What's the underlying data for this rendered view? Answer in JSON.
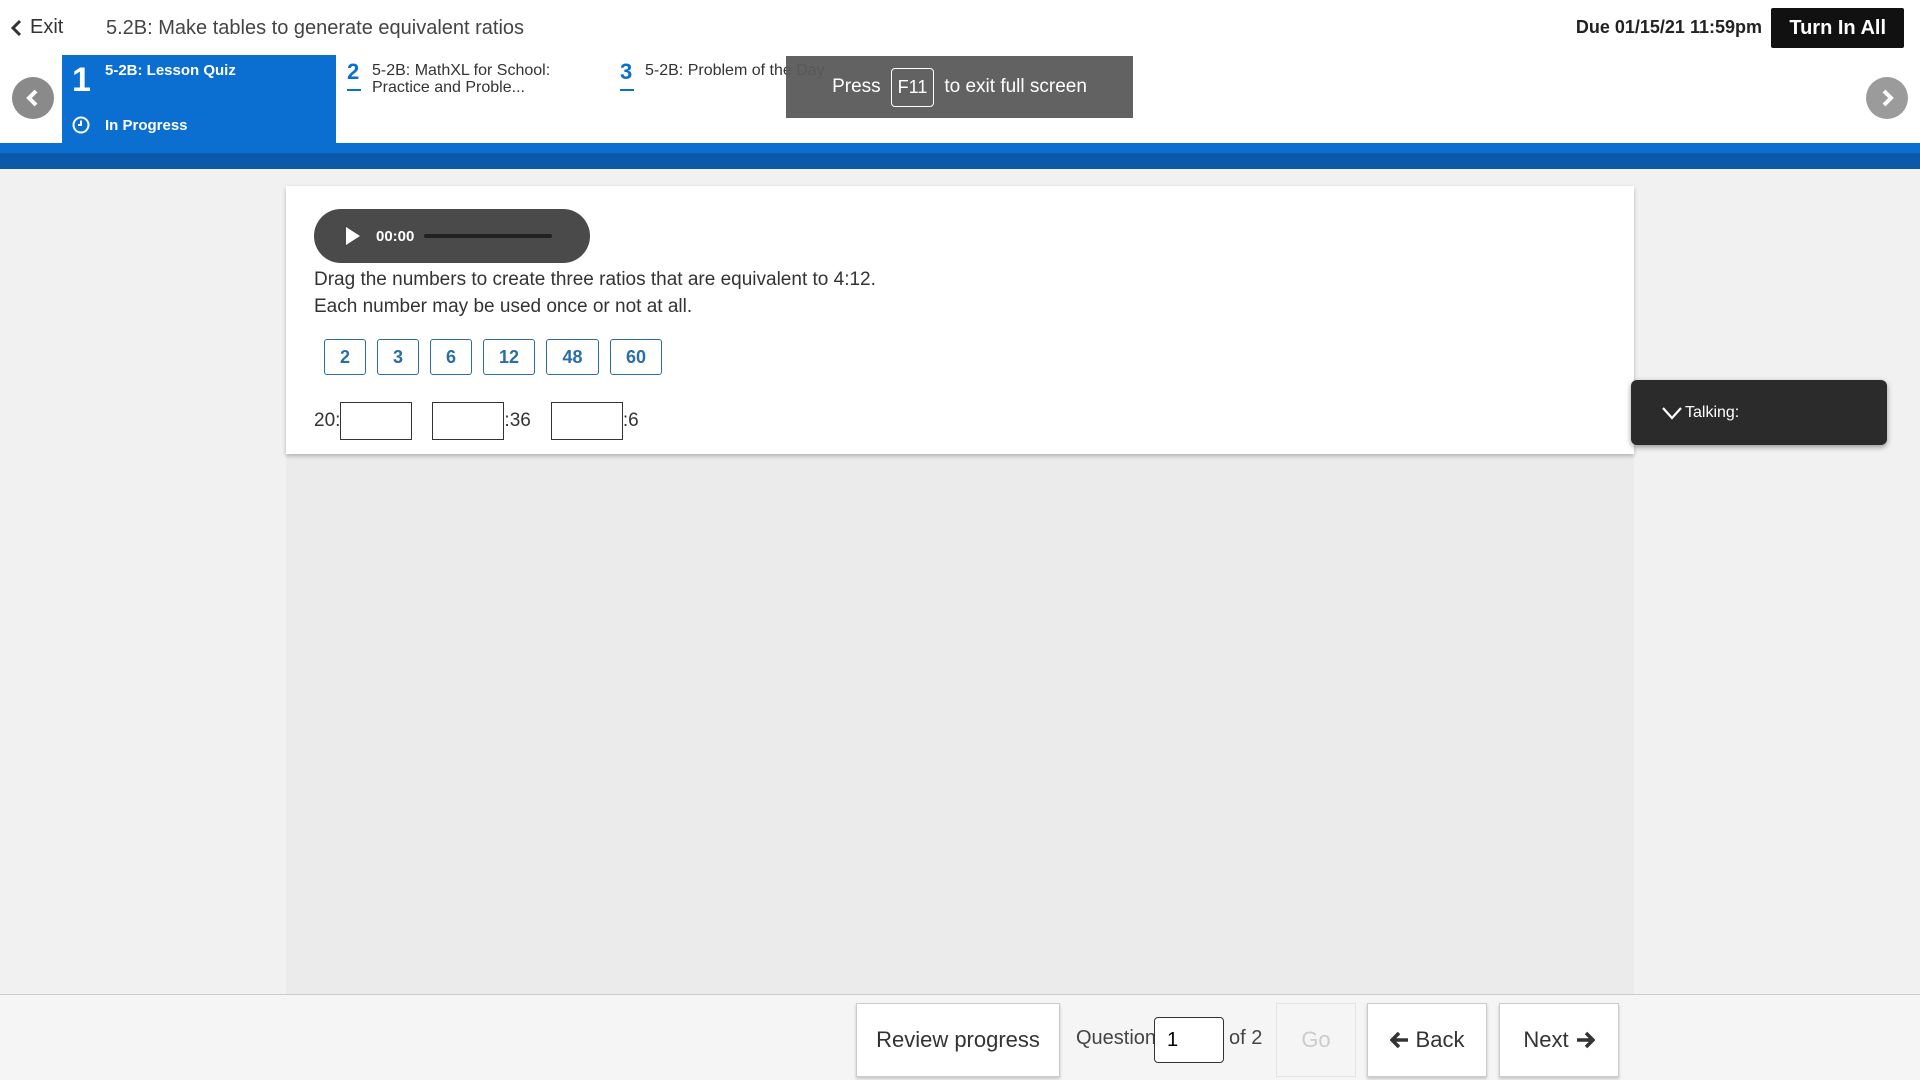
{
  "header": {
    "exit_label": "Exit",
    "assignment_title": "5.2B: Make tables to generate equivalent ratios",
    "due": "Due 01/15/21 11:59pm",
    "turn_in_label": "Turn In All"
  },
  "tabs": [
    {
      "number": "1",
      "title": "5-2B: Lesson Quiz",
      "status": "In Progress"
    },
    {
      "number": "2",
      "title": "5-2B: MathXL for School: Practice and Proble..."
    },
    {
      "number": "3",
      "title": "5-2B: Problem of the Day"
    }
  ],
  "fullscreen_toast": {
    "press": "Press",
    "key": "F11",
    "rest": "to exit full screen"
  },
  "audio": {
    "time": "00:00"
  },
  "question": {
    "line1": "Drag the numbers to create three ratios that are equivalent to 4:12.",
    "line2": "Each number may be used once or not at all.",
    "tiles": [
      "2",
      "3",
      "6",
      "12",
      "48",
      "60"
    ],
    "ratio1_prefix": "20:",
    "ratio2_suffix": ":36",
    "ratio3_suffix": ":6"
  },
  "talking": {
    "label": "Talking:"
  },
  "footer": {
    "review_label": "Review progress",
    "question_label": "Question",
    "question_value": "1",
    "of_label": "of 2",
    "go_label": "Go",
    "back_label": "Back",
    "next_label": "Next"
  },
  "colors": {
    "accent": "#0a6fd0",
    "tile": "#2a6ea8"
  }
}
